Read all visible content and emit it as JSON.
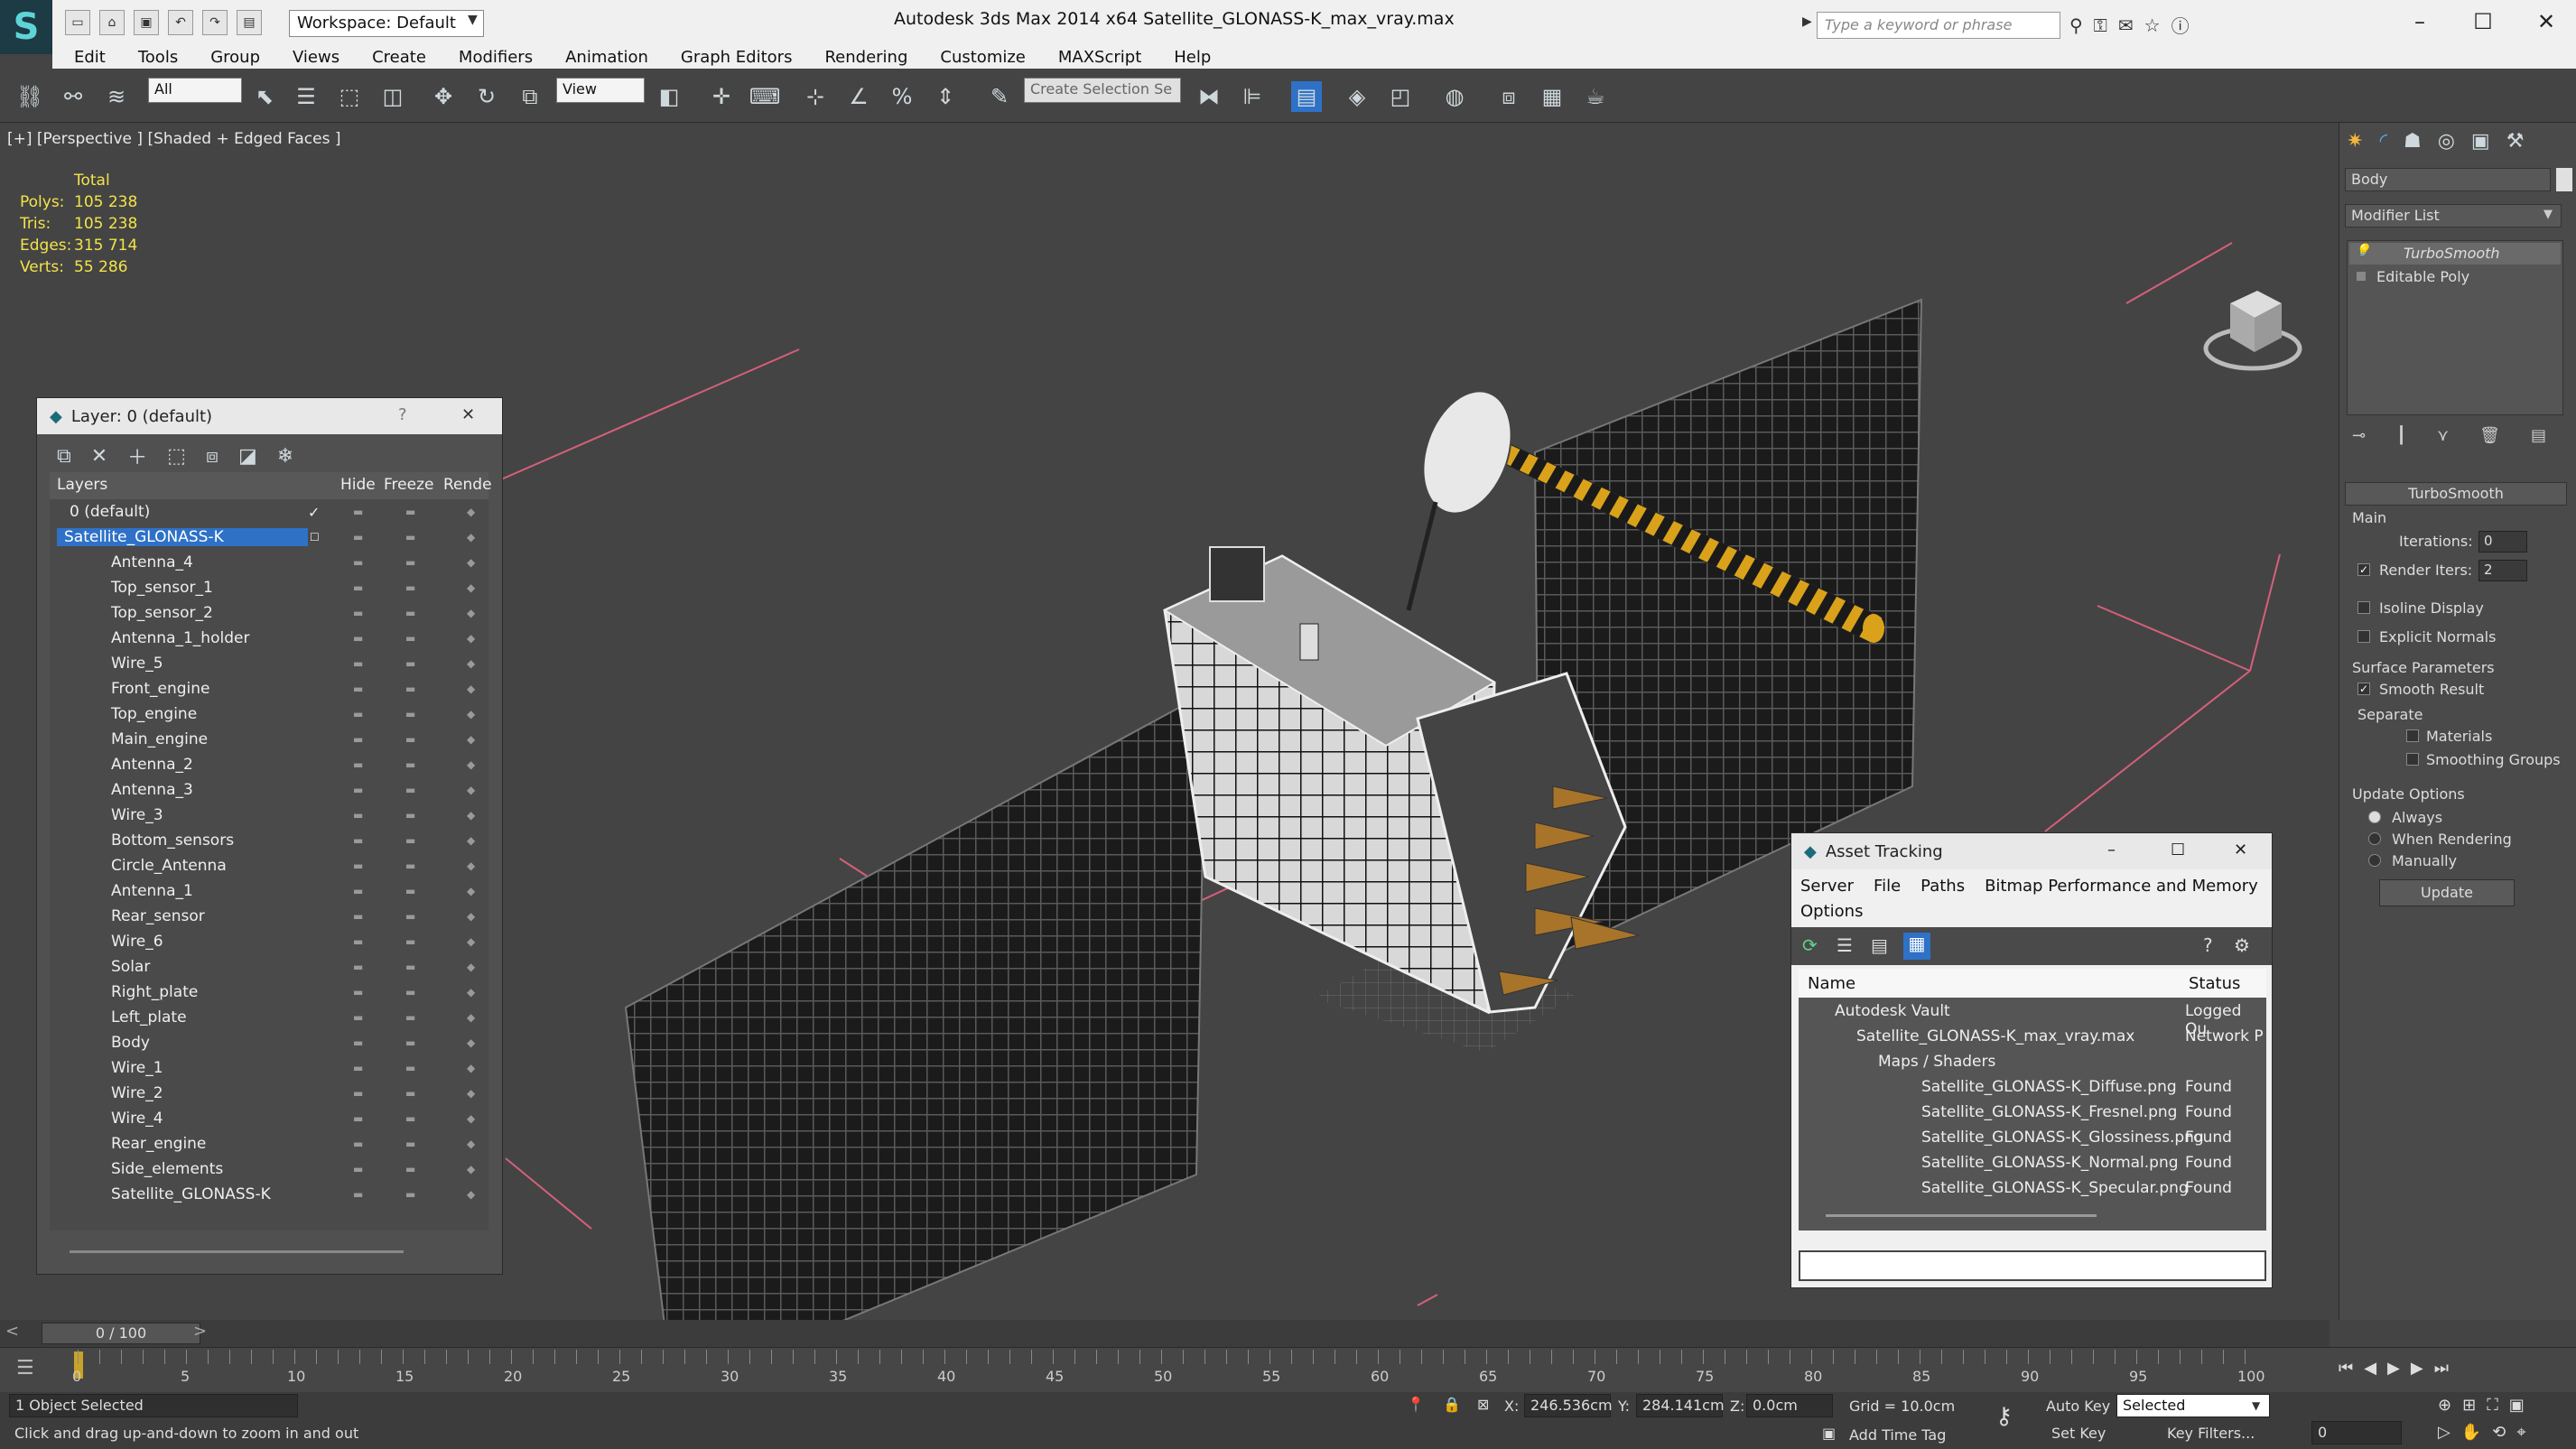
{
  "title_bar": {
    "workspace": "Workspace: Default",
    "app_title": "Autodesk 3ds Max  2014 x64       Satellite_GLONASS-K_max_vray.max",
    "search_placeholder": "Type a keyword or phrase"
  },
  "menu": [
    "Edit",
    "Tools",
    "Group",
    "Views",
    "Create",
    "Modifiers",
    "Animation",
    "Graph Editors",
    "Rendering",
    "Customize",
    "MAXScript",
    "Help"
  ],
  "toolbar": {
    "selection_filter": "All",
    "ref_coord": "View",
    "named_selection": "Create Selection Se"
  },
  "viewport": {
    "label": "[+] [Perspective ] [Shaded + Edged Faces ]",
    "stats": {
      "header": "Total",
      "polys_label": "Polys:",
      "polys": "105 238",
      "tris_label": "Tris:",
      "tris": "105 238",
      "edges_label": "Edges:",
      "edges": "315 714",
      "verts_label": "Verts:",
      "verts": "55 286"
    }
  },
  "layer_panel": {
    "title": "Layer: 0 (default)",
    "columns": {
      "layers": "Layers",
      "hide": "Hide",
      "freeze": "Freeze",
      "render": "Rende"
    },
    "rows": [
      "0 (default)",
      "Satellite_GLONASS-K",
      "Antenna_4",
      "Top_sensor_1",
      "Top_sensor_2",
      "Antenna_1_holder",
      "Wire_5",
      "Front_engine",
      "Top_engine",
      "Main_engine",
      "Antenna_2",
      "Antenna_3",
      "Wire_3",
      "Bottom_sensors",
      "Circle_Antenna",
      "Antenna_1",
      "Rear_sensor",
      "Wire_6",
      "Solar",
      "Right_plate",
      "Left_plate",
      "Body",
      "Wire_1",
      "Wire_2",
      "Wire_4",
      "Rear_engine",
      "Side_elements",
      "Satellite_GLONASS-K"
    ]
  },
  "asset_panel": {
    "title": "Asset Tracking",
    "menu": [
      "Server",
      "File",
      "Paths",
      "Bitmap Performance and Memory",
      "Options"
    ],
    "columns": {
      "name": "Name",
      "status": "Status"
    },
    "rows": [
      {
        "name": "Autodesk Vault",
        "status": "Logged Ou"
      },
      {
        "name": "Satellite_GLONASS-K_max_vray.max",
        "status": "Network P"
      },
      {
        "name": "Maps / Shaders",
        "status": ""
      },
      {
        "name": "Satellite_GLONASS-K_Diffuse.png",
        "status": "Found"
      },
      {
        "name": "Satellite_GLONASS-K_Fresnel.png",
        "status": "Found"
      },
      {
        "name": "Satellite_GLONASS-K_Glossiness.png",
        "status": "Found"
      },
      {
        "name": "Satellite_GLONASS-K_Normal.png",
        "status": "Found"
      },
      {
        "name": "Satellite_GLONASS-K_Specular.png",
        "status": "Found"
      }
    ]
  },
  "command_panel": {
    "object_name": "Body",
    "modifier_list": "Modifier List",
    "stack": [
      "TurboSmooth",
      "Editable Poly"
    ],
    "rollout_title": "TurboSmooth",
    "main_label": "Main",
    "iterations_label": "Iterations:",
    "iterations": "0",
    "render_iters_label": "Render Iters:",
    "render_iters": "2",
    "isoline": "Isoline Display",
    "explicit_normals": "Explicit Normals",
    "surface_params": "Surface Parameters",
    "smooth_result": "Smooth Result",
    "separate": "Separate",
    "materials": "Materials",
    "smoothing_groups": "Smoothing Groups",
    "update_options": "Update Options",
    "always": "Always",
    "when_rendering": "When Rendering",
    "manually": "Manually",
    "update_button": "Update"
  },
  "timeline": {
    "frame_counter": "0 / 100",
    "ticks": [
      "0",
      "5",
      "10",
      "15",
      "20",
      "25",
      "30",
      "35",
      "40",
      "45",
      "50",
      "55",
      "60",
      "65",
      "70",
      "75",
      "80",
      "85",
      "90",
      "95",
      "100"
    ]
  },
  "status_bar": {
    "selected": "1 Object Selected",
    "prompt": "Click and drag up-and-down to zoom in and out",
    "x_label": "X:",
    "x": "246.536cm",
    "y_label": "Y:",
    "y": "284.141cm",
    "z_label": "Z:",
    "z": "0.0cm",
    "grid": "Grid = 10.0cm",
    "add_time_tag": "Add Time Tag",
    "auto_key": "Auto Key",
    "set_key": "Set Key",
    "key_mode": "Selected",
    "key_filters": "Key Filters...",
    "current_frame": "0"
  }
}
